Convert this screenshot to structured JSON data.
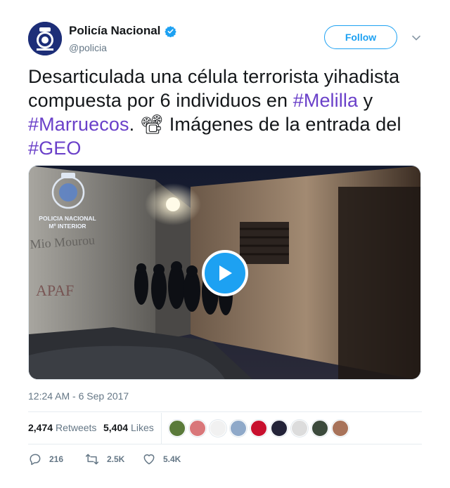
{
  "author": {
    "display_name": "Policía Nacional",
    "handle": "@policia",
    "verified": true,
    "verified_color": "#1da1f2",
    "avatar_icon": "policia-nacional-crest"
  },
  "follow_button": {
    "label": "Follow"
  },
  "menu_icon": "chevron-down-icon",
  "tweet": {
    "text_segments": [
      {
        "type": "text",
        "text": "Desarticulada una célula terrorista yihadista compuesta por 6 individuos en "
      },
      {
        "type": "hashtag",
        "text": "#Melilla"
      },
      {
        "type": "text",
        "text": " y "
      },
      {
        "type": "hashtag",
        "text": "#Marruecos"
      },
      {
        "type": "text",
        "text": ". "
      },
      {
        "type": "emoji",
        "text": "📽",
        "icon": "film-projector-icon"
      },
      {
        "type": "text",
        "text": " Imágenes de la entrada del "
      },
      {
        "type": "hashtag",
        "text": "#GEO"
      }
    ],
    "hashtag_color": "#6a40c9"
  },
  "media": {
    "watermark_line1": "POLICIA NACIONAL",
    "watermark_line2": "Mº INTERIOR",
    "wall_text": "Mio Mourou",
    "wall_text_2": "APAF",
    "play_icon": "play-icon",
    "play_color": "#1da1f2"
  },
  "timestamp": "12:24 AM - 6 Sep 2017",
  "stats": {
    "retweets_count": "2,474",
    "retweets_label": "Retweets",
    "likes_count": "5,404",
    "likes_label": "Likes"
  },
  "likers": [
    {
      "name": "liker-avatar-1",
      "color": "#5a7a3a"
    },
    {
      "name": "liker-avatar-2",
      "color": "#d9777a"
    },
    {
      "name": "liker-avatar-3",
      "color": "#f1f1f1"
    },
    {
      "name": "liker-avatar-4",
      "color": "#8fa9c9"
    },
    {
      "name": "liker-avatar-5",
      "color": "#c8102e"
    },
    {
      "name": "liker-avatar-6",
      "color": "#232338"
    },
    {
      "name": "liker-avatar-7",
      "color": "#dcdcdc"
    },
    {
      "name": "liker-avatar-8",
      "color": "#3c4a3c"
    },
    {
      "name": "liker-avatar-9",
      "color": "#a8735a"
    }
  ],
  "actions": {
    "reply_count": "216",
    "retweet_count": "2.5K",
    "like_count": "5.4K"
  }
}
